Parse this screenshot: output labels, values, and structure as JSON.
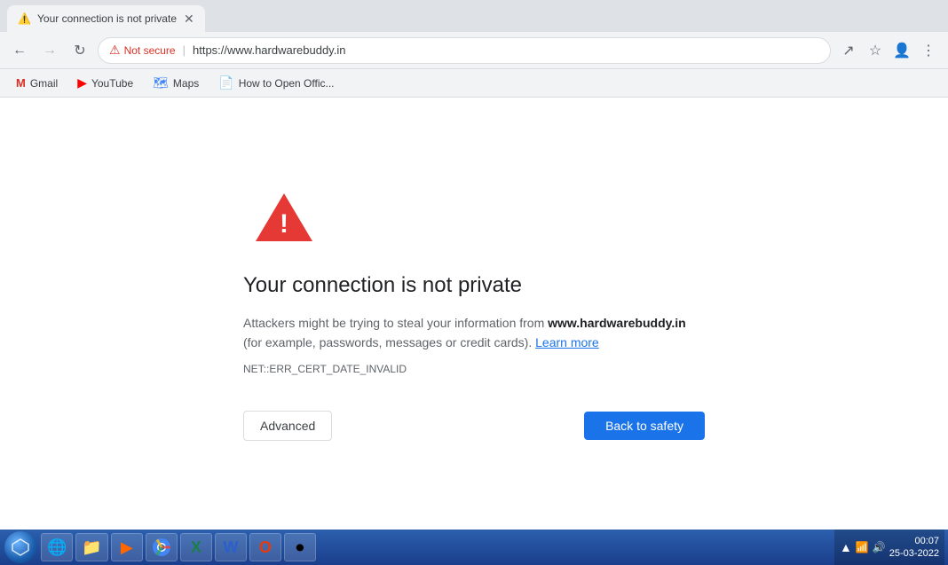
{
  "browser": {
    "tab": {
      "title": "Your connection is not private",
      "favicon": "⚠"
    },
    "nav": {
      "back_disabled": false,
      "forward_disabled": true
    },
    "address_bar": {
      "not_secure_label": "Not secure",
      "url": "https://www.hardwarebuddy.in"
    },
    "bookmarks": [
      {
        "label": "Gmail",
        "icon": "M"
      },
      {
        "label": "YouTube",
        "icon": "▶"
      },
      {
        "label": "Maps",
        "icon": "📍"
      },
      {
        "label": "How to Open Offic...",
        "icon": "📄"
      }
    ]
  },
  "error_page": {
    "title": "Your connection is not private",
    "description_prefix": "Attackers might be trying to steal your information from ",
    "domain": "www.hardwarebuddy.in",
    "description_suffix": " (for example, passwords, messages or credit cards).",
    "learn_more_label": "Learn more",
    "error_code": "NET::ERR_CERT_DATE_INVALID",
    "btn_advanced": "Advanced",
    "btn_back_to_safety": "Back to safety"
  },
  "taskbar": {
    "time": "00:07",
    "date": "25-03-2022",
    "apps": [
      {
        "icon": "🪟",
        "color": "#e05c0a"
      },
      {
        "icon": "🌐",
        "color": "#1e90ff"
      },
      {
        "icon": "📁",
        "color": "#f5a623"
      },
      {
        "icon": "▶",
        "color": "#e05c0a"
      },
      {
        "icon": "🟡",
        "color": "#f5d020"
      },
      {
        "icon": "📊",
        "color": "#1b7f4a"
      },
      {
        "icon": "W",
        "color": "#2b5fcc"
      },
      {
        "icon": "O",
        "color": "#e8390e"
      },
      {
        "icon": "⏺",
        "color": "#cc0000"
      }
    ]
  }
}
